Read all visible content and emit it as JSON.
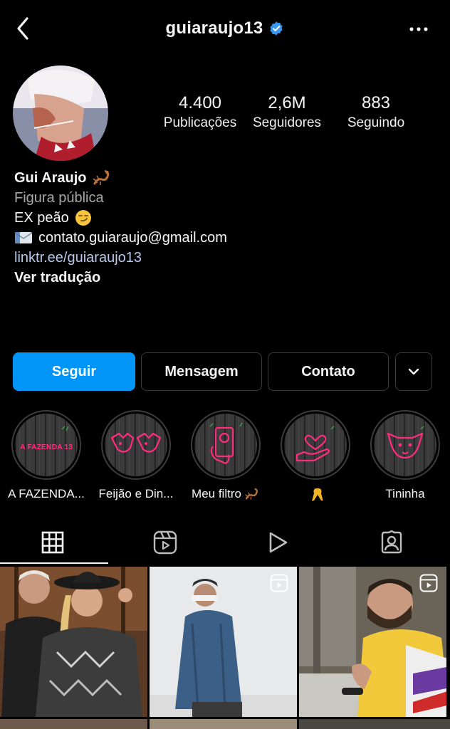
{
  "header": {
    "username": "guiaraujo13"
  },
  "stats": [
    {
      "value": "4.400",
      "label": "Publicações"
    },
    {
      "value": "2,6M",
      "label": "Seguidores"
    },
    {
      "value": "883",
      "label": "Seguindo"
    }
  ],
  "bio": {
    "name": "Gui Araujo",
    "category": "Figura pública",
    "line1": "EX peão",
    "email": "contato.guiaraujo@gmail.com",
    "link": "linktr.ee/guiaraujo13",
    "translate": "Ver tradução"
  },
  "buttons": {
    "follow": "Seguir",
    "message": "Mensagem",
    "contact": "Contato"
  },
  "highlights": [
    {
      "label": "A FAZENDA...",
      "cover_text": "A FAZENDA 13"
    },
    {
      "label": "Feijão e Din..."
    },
    {
      "label": "Meu filtro"
    },
    {
      "label": ""
    },
    {
      "label": "Tininha"
    }
  ],
  "colors": {
    "background": "#000000",
    "follow_button": "#0095f6",
    "neon_pink": "#ff2d7a",
    "verified": "#3897f0",
    "link": "#b7c9ea"
  },
  "icons": {
    "back": "chevron-left-icon",
    "verified": "verified-badge-icon",
    "more": "more-horizontal-icon",
    "dropdown": "chevron-down-icon",
    "tabs": [
      "grid-icon",
      "reels-icon",
      "play-icon",
      "tagged-icon"
    ]
  }
}
